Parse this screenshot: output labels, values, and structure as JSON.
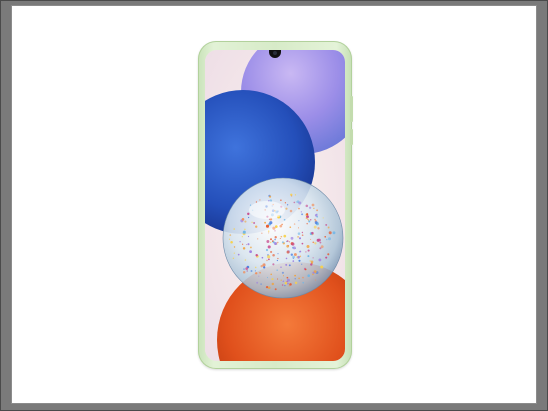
{
  "image": {
    "subject": "smartphone-front-view",
    "colors": {
      "frame": "#d7ebc8",
      "wallpaper_blue": "#2f5fc8",
      "wallpaper_violet": "#8f7ee0",
      "wallpaper_orange": "#e4521e",
      "wallpaper_background": "#f3e6ea"
    }
  }
}
